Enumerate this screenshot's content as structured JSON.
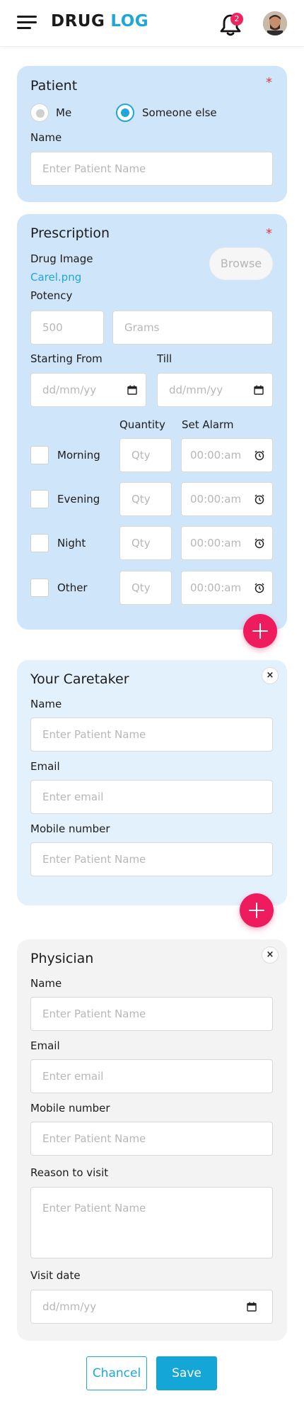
{
  "header": {
    "app_name_part1": "DRUG",
    "app_name_part2": "LOG",
    "notification_count": "2",
    "icons": [
      "menu-icon",
      "bell-icon",
      "avatar"
    ]
  },
  "patient": {
    "title": "Patient",
    "required_mark": "*",
    "option_me": "Me",
    "option_someone_else": "Someone else",
    "selected": "Someone else",
    "name_label": "Name",
    "name_placeholder": "Enter Patient Name"
  },
  "prescription": {
    "title": "Prescription",
    "required_mark": "*",
    "drug_image_label": "Drug Image",
    "drug_image_file": "Carel.png",
    "browse_label": "Browse",
    "potency_label": "Potency",
    "potency_value_placeholder": "500",
    "potency_unit_placeholder": "Grams",
    "start_label": "Starting From",
    "till_label": "Till",
    "date_placeholder": "dd/mm/yy",
    "quantity_header": "Quantity",
    "alarm_header": "Set Alarm",
    "qty_placeholder": "Qty",
    "time_placeholder": "00:00:am",
    "slots": [
      {
        "label": "Morning"
      },
      {
        "label": "Evening"
      },
      {
        "label": "Night"
      },
      {
        "label": "Other"
      }
    ]
  },
  "caretaker": {
    "title": "Your Caretaker",
    "close_label": "×",
    "name_label": "Name",
    "name_placeholder": "Enter Patient Name",
    "email_label": "Email",
    "email_placeholder": "Enter email",
    "mobile_label": "Mobile number",
    "mobile_placeholder": "Enter Patient Name"
  },
  "physician": {
    "title": "Physician",
    "close_label": "×",
    "name_label": "Name",
    "name_placeholder": "Enter Patient Name",
    "email_label": "Email",
    "email_placeholder": "Enter email",
    "mobile_label": "Mobile number",
    "mobile_placeholder": "Enter Patient Name",
    "reason_label": "Reason to visit",
    "reason_placeholder": "Enter Patient Name",
    "visit_date_label": "Visit date",
    "visit_date_placeholder": "dd/mm/yy"
  },
  "actions": {
    "cancel_label": "Chancel",
    "save_label": "Save"
  },
  "colors": {
    "accent": "#1ea7d8",
    "fab": "#ee1c5e",
    "card_blue": "#cfe5fa",
    "card_light": "#e3f1fd",
    "card_grey": "#f3f3f3"
  }
}
